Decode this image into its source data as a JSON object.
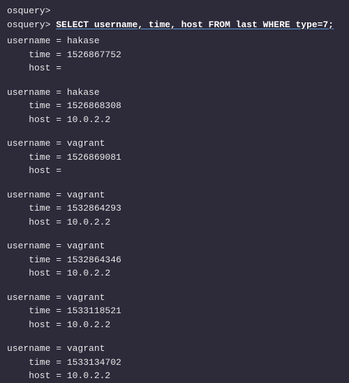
{
  "prompt": "osquery>",
  "prompt_spacer": " ",
  "query": "SELECT username, time, host FROM last WHERE type=7;",
  "labels": {
    "username": "username",
    "time": "time",
    "host": "host",
    "eq": " = "
  },
  "records": [
    {
      "username": "hakase",
      "time": "1526867752",
      "host": ""
    },
    {
      "username": "hakase",
      "time": "1526868308",
      "host": "10.0.2.2"
    },
    {
      "username": "vagrant",
      "time": "1526869081",
      "host": ""
    },
    {
      "username": "vagrant",
      "time": "1532864293",
      "host": "10.0.2.2"
    },
    {
      "username": "vagrant",
      "time": "1532864346",
      "host": "10.0.2.2"
    },
    {
      "username": "vagrant",
      "time": "1533118521",
      "host": "10.0.2.2"
    },
    {
      "username": "vagrant",
      "time": "1533134702",
      "host": "10.0.2.2"
    }
  ]
}
